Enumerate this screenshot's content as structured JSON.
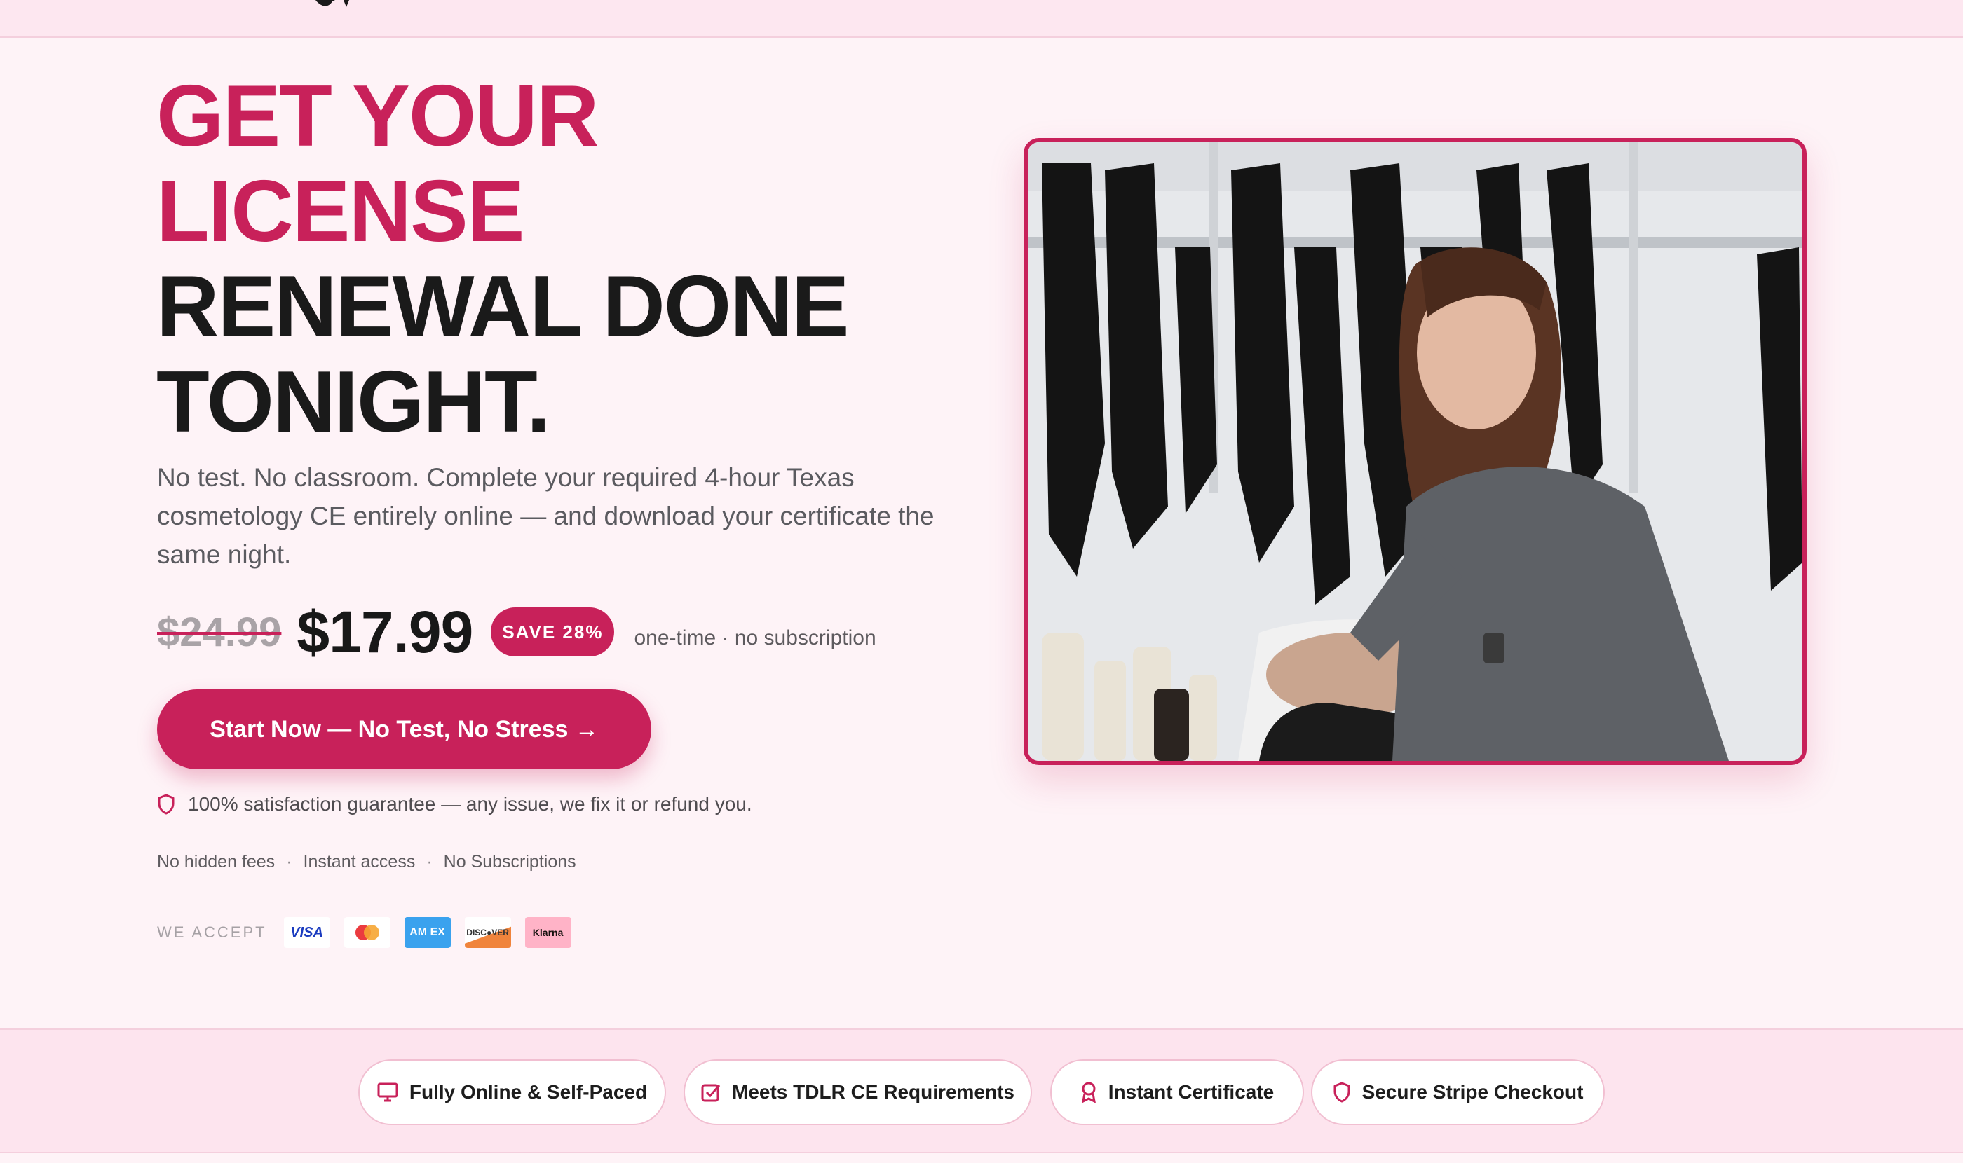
{
  "headline": {
    "accent_line1": "GET YOUR",
    "accent_line2": "LICENSE",
    "dark_line1": "RENEWAL DONE",
    "dark_line2": "TONIGHT."
  },
  "subtext": "No test. No classroom. Complete your required 4-hour Texas cosmetology CE entirely online — and download your certificate the same night.",
  "pricing": {
    "old_price": "$24.99",
    "new_price": "$17.99",
    "save_badge": "SAVE 28%",
    "note": "one-time · no subscription"
  },
  "cta": {
    "label": "Start Now — No Test, No Stress →"
  },
  "guarantee": {
    "text": "100% satisfaction guarantee — any issue, we fix it or refund you."
  },
  "features_line": [
    "No hidden fees",
    "Instant access",
    "No Subscriptions"
  ],
  "features_separator": "·",
  "payments": {
    "label": "WE ACCEPT",
    "cards": [
      {
        "name": "visa-icon",
        "text": "VISA"
      },
      {
        "name": "mastercard-icon",
        "text": ""
      },
      {
        "name": "amex-icon",
        "text": "AM EX"
      },
      {
        "name": "discover-icon",
        "text": "DISC●VER"
      },
      {
        "name": "klarna-icon",
        "text": "Klarna"
      }
    ]
  },
  "trust_badges": [
    {
      "label": "Fully Online & Self-Paced",
      "icon": "monitor-icon"
    },
    {
      "label": "Meets TDLR CE Requirements",
      "icon": "checklist-icon"
    },
    {
      "label": "Instant Certificate",
      "icon": "award-icon"
    },
    {
      "label": "Secure Stripe Checkout",
      "icon": "shield-icon"
    }
  ],
  "colors": {
    "accent": "#c8215a",
    "background": "#fef3f7",
    "trust_bar": "#fde4ee"
  }
}
